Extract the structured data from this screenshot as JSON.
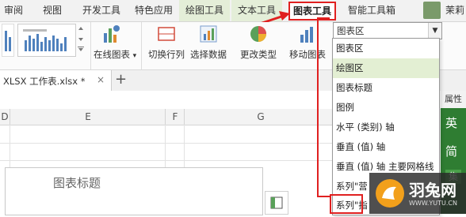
{
  "tabs": [
    {
      "label": "审阅"
    },
    {
      "label": "视图"
    },
    {
      "label": "开发工具"
    },
    {
      "label": "特色应用"
    },
    {
      "label": "绘图工具"
    },
    {
      "label": "文本工具"
    },
    {
      "label": "图表工具"
    },
    {
      "label": "智能工具箱"
    },
    {
      "label": "茉莉"
    }
  ],
  "ribbon": {
    "online_chart": "在线图表",
    "switch_row_col": "切换行列",
    "select_data": "选择数据",
    "change_type": "更改类型",
    "move_chart": "移动图表"
  },
  "element_select": {
    "value": "图表区"
  },
  "dropdown_options": [
    {
      "label": "图表区"
    },
    {
      "label": "绘图区"
    },
    {
      "label": "图表标题"
    },
    {
      "label": "图例"
    },
    {
      "label": "水平 (类别) 轴"
    },
    {
      "label": "垂直 (值) 轴"
    },
    {
      "label": "垂直 (值) 轴 主要网格线"
    },
    {
      "label": "系列\"营"
    },
    {
      "label": "系列\"指"
    }
  ],
  "doc_tab": {
    "label": "XLSX 工作表.xlsx *",
    "add": "+"
  },
  "columns": [
    "D",
    "E",
    "F",
    "G"
  ],
  "chart": {
    "title": "图表标题"
  },
  "right_panel": {
    "label": "属性",
    "item_a": "英",
    "item_b": "简",
    "badge": "集"
  },
  "watermark": {
    "brand": "羽兔网",
    "url": "WWW.YUTU.CN"
  },
  "colors": {
    "accent_red": "#e02020",
    "highlight": "#e3efd3",
    "green_panel": "#2f7d32"
  }
}
